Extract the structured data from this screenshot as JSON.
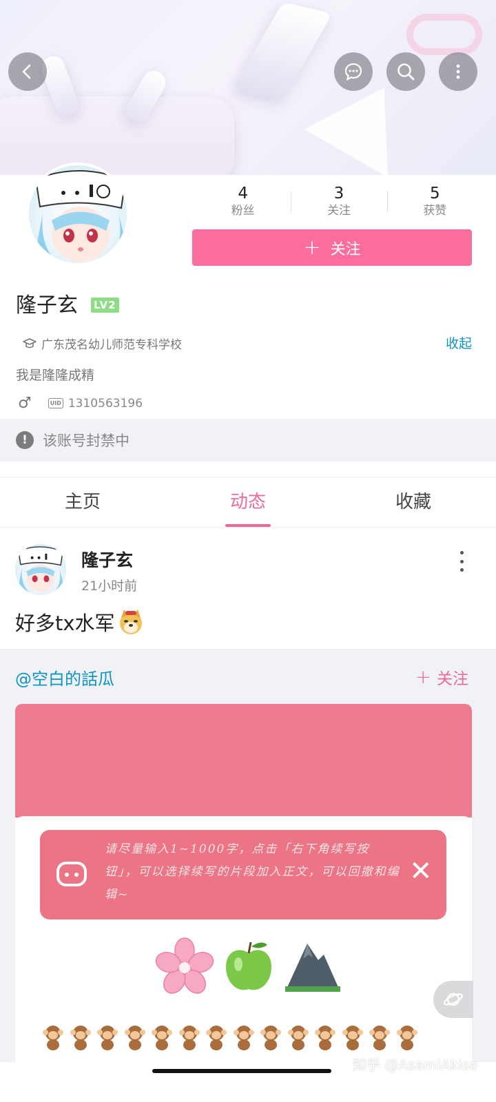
{
  "header": {
    "back_icon": "chevron-left-icon",
    "actions": [
      "chat-bubble-icon",
      "search-icon",
      "more-vertical-icon"
    ]
  },
  "profile": {
    "stats": [
      {
        "value": "4",
        "label": "粉丝"
      },
      {
        "value": "3",
        "label": "关注"
      },
      {
        "value": "5",
        "label": "获赞"
      }
    ],
    "follow_label": "关注",
    "username": "隆子玄",
    "level": "LV2",
    "school": "广东茂名幼儿师范专科学校",
    "collapse_label": "收起",
    "bio": "我是隆隆成精",
    "gender_symbol": "♂",
    "uid_badge": "UID",
    "uid": "1310563196"
  },
  "ban_notice": {
    "icon": "!",
    "text": "该账号封禁中"
  },
  "tabs": [
    {
      "label": "主页",
      "active": false
    },
    {
      "label": "动态",
      "active": true
    },
    {
      "label": "收藏",
      "active": false
    }
  ],
  "post": {
    "author": "隆子玄",
    "time": "21小时前",
    "text": "好多tx水军"
  },
  "repost": {
    "author": "@空白的話瓜",
    "follow_label": "关注",
    "tip_text": "请尽量输入1~1000字，点击「右下角续写按钮」，可以选择续写的片段加入正文，可以回撤和编辑~"
  },
  "watermark": "知乎 @AsamiAkise",
  "colors": {
    "accent_pink": "#fb6e9c",
    "link_blue": "#0d93c4",
    "level_green": "#8fdc86"
  }
}
